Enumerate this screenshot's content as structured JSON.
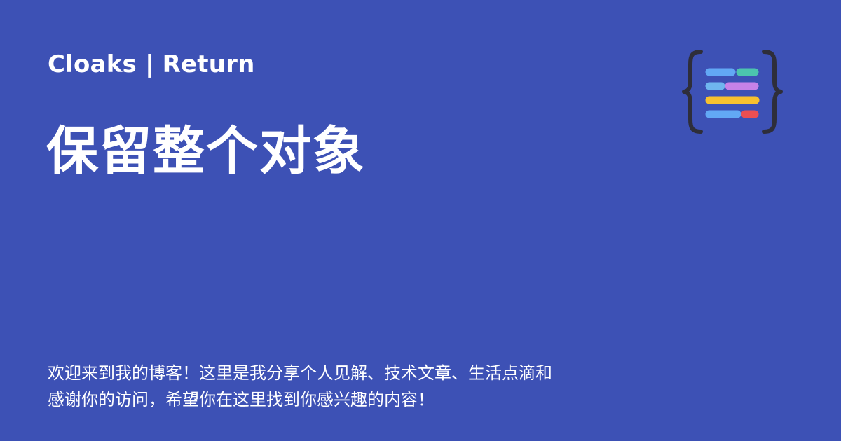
{
  "header": {
    "site_name": "Cloaks | Return"
  },
  "main": {
    "title": "保留整个对象"
  },
  "footer": {
    "description_line1": "欢迎来到我的博客！这里是我分享个人见解、技术文章、生活点滴和",
    "description_line2": "感谢你的访问，希望你在这里找到你感兴趣的内容！"
  },
  "colors": {
    "background": "#3d51b5",
    "text": "#ffffff",
    "logo_brace": "#2e2e3a",
    "logo_bar_blue": "#62a8f5",
    "logo_bar_teal": "#4cc4ae",
    "logo_bar_lightblue": "#6fb6ef",
    "logo_bar_purple": "#c782e8",
    "logo_bar_yellow": "#f7c12f",
    "logo_bar_red": "#ec4f52"
  },
  "icons": {
    "logo": "curly-braces-code-lines-logo"
  }
}
